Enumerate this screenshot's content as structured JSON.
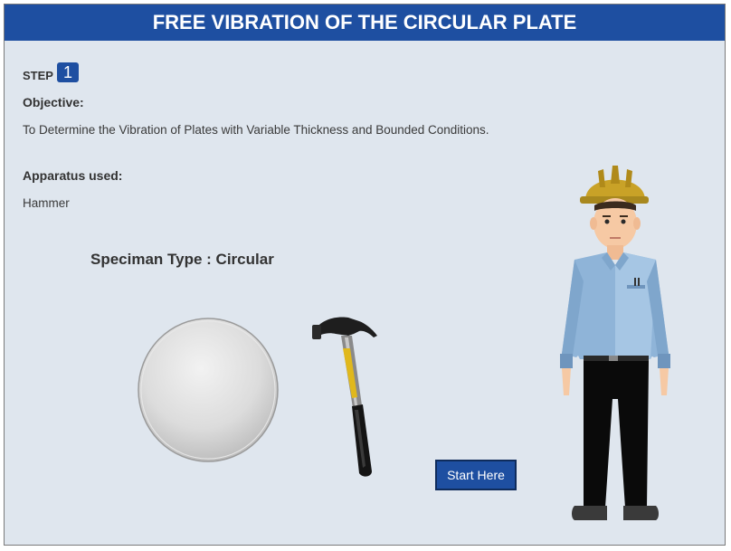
{
  "header": {
    "title": "FREE VIBRATION OF THE CIRCULAR PLATE"
  },
  "step": {
    "label": "STEP",
    "number": "1"
  },
  "objective": {
    "heading": "Objective:",
    "text": "To Determine the Vibration of Plates with Variable Thickness and Bounded Conditions."
  },
  "apparatus": {
    "heading": "Apparatus used:",
    "text": "Hammer"
  },
  "specimen": {
    "title": "Speciman Type : Circular"
  },
  "actions": {
    "start_label": "Start Here"
  },
  "colors": {
    "header_bg": "#1e4fa1",
    "panel_bg": "#dfe6ee",
    "button_bg": "#1e4fa1"
  }
}
